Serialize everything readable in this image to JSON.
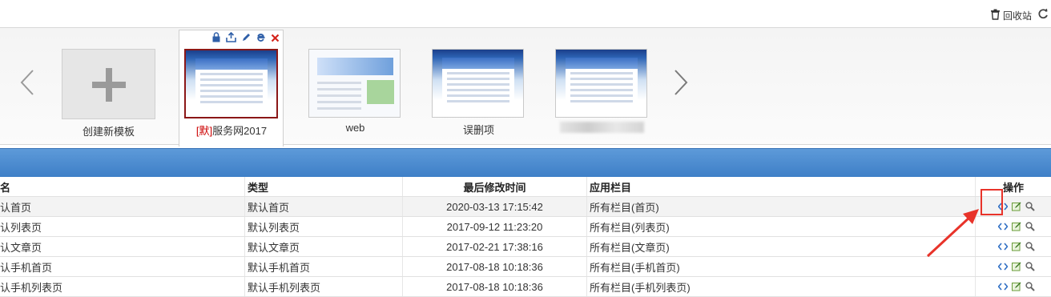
{
  "topbar": {
    "recycle_label": "回收站"
  },
  "templates": {
    "add_label": "创建新模板",
    "default_mark": "[默]",
    "items": [
      {
        "name": "服务网2017"
      },
      {
        "name": "web"
      },
      {
        "name": "误删项"
      }
    ]
  },
  "table": {
    "headers": {
      "name": "名",
      "type": "类型",
      "time": "最后修改时间",
      "apply": "应用栏目",
      "ops": "操作"
    },
    "rows": [
      {
        "name": "认首页",
        "type": "默认首页",
        "time": "2020-03-13 17:15:42",
        "apply": "所有栏目(首页)"
      },
      {
        "name": "认列表页",
        "type": "默认列表页",
        "time": "2017-09-12 11:23:20",
        "apply": "所有栏目(列表页)"
      },
      {
        "name": "认文章页",
        "type": "默认文章页",
        "time": "2017-02-21 17:38:16",
        "apply": "所有栏目(文章页)"
      },
      {
        "name": "认手机首页",
        "type": "默认手机首页",
        "time": "2017-08-18 10:18:36",
        "apply": "所有栏目(手机首页)"
      },
      {
        "name": "认手机列表页",
        "type": "默认手机列表页",
        "time": "2017-08-18 10:18:36",
        "apply": "所有栏目(手机列表页)"
      }
    ]
  },
  "colors": {
    "band": "#4a8ad0",
    "highlight": "#e8332a",
    "default_mark": "#cc0000"
  }
}
